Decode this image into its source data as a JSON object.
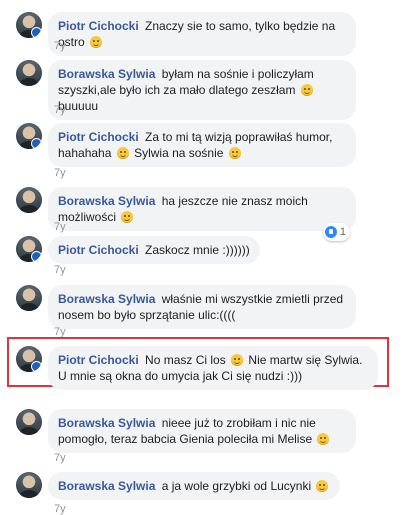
{
  "comments": [
    {
      "author": "Piotr Cichocki",
      "badge": true,
      "text": "Znaczy sie to samo, tylko będzie na ostro",
      "emoji": true,
      "time": "7y"
    },
    {
      "author": "Borawska Sylwia",
      "badge": false,
      "text": "byłam na sośnie i policzyłam szyszki,ale było ich za mało dlatego zeszłam",
      "emoji": true,
      "text_after": "buuuuu",
      "time": "7y"
    },
    {
      "author": "Piotr Cichocki",
      "badge": true,
      "text": "Za to mi tą wizją poprawiłaś humor, hahahaha",
      "emoji": true,
      "text_after": "Sylwia na sośnie",
      "emoji2": true,
      "time": "7y"
    },
    {
      "author": "Borawska Sylwia",
      "badge": false,
      "text": "ha jeszcze nie znasz moich możliwości",
      "emoji": true,
      "time": "7y",
      "reaction_count": "1"
    },
    {
      "author": "Piotr Cichocki",
      "badge": true,
      "text": "Zaskocz mnie :))))))",
      "time": "7y"
    },
    {
      "author": "Borawska Sylwia",
      "badge": false,
      "text": "właśnie mi wszystkie zmietli przed nosem bo było sprzątanie ulic:((((",
      "time": "7y"
    },
    {
      "author": "Piotr Cichocki",
      "badge": true,
      "text": "No masz Ci los",
      "emoji": true,
      "text_after": "Nie martw się Sylwia. U mnie są okna do umycia jak Ci się nudzi :)))",
      "time": "7y"
    },
    {
      "author": "Borawska Sylwia",
      "badge": false,
      "text": "nieee już to zrobiłam i nic nie pomogło, teraz babcia Gienia poleciła mi Melise",
      "emoji": true,
      "time": "7y"
    },
    {
      "author": "Borawska Sylwia",
      "badge": false,
      "text": "a ja wole grzybki od Lucynki",
      "emoji": true,
      "time": "7y"
    }
  ],
  "colors": {
    "author": "#385898",
    "bubble": "#f2f3f5",
    "highlight": "#e3323c",
    "time": "#90949c"
  }
}
